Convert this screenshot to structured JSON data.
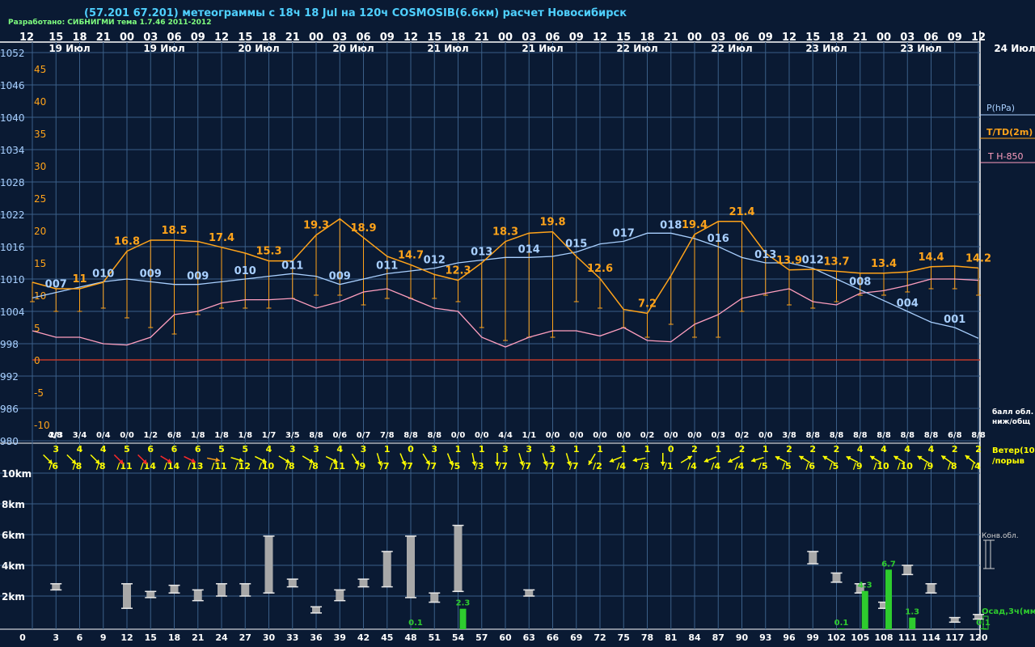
{
  "header": {
    "title": "(57.201 67.201) метеограммы с  18ч 18 Jul на 120ч COSMOSIB(6.6км) расчет Новосибирск",
    "developer": "Разработано: СИБНИГМИ тема 1.7.46 2011-2012"
  },
  "colors": {
    "background": "#0a1a33",
    "grid": "#3b5f88",
    "pressure": "#a9d0ff",
    "temperature": "#ffa31a",
    "t850": "#ff9fbf",
    "zero_line": "#c0392b",
    "cloud_bar": "#a8a8a8",
    "precip_bar": "#2ecc2e",
    "wind_yellow": "#ffff00",
    "wind_orange": "#ffa31a",
    "wind_red": "#ff2a2a"
  },
  "top_hours": [
    "12",
    "15",
    "18",
    "21",
    "00",
    "03",
    "06",
    "09",
    "12",
    "15",
    "18",
    "21",
    "00",
    "03",
    "06",
    "09",
    "12",
    "15",
    "18",
    "21",
    "00",
    "03",
    "06",
    "09",
    "12",
    "15",
    "18",
    "21",
    "00",
    "03",
    "06",
    "09",
    "12",
    "15",
    "18",
    "21",
    "00",
    "03",
    "06",
    "09",
    "12"
  ],
  "date_labels": [
    "19 Июл",
    "19 Июл",
    "20 Июл",
    "20 Июл",
    "21 Июл",
    "21 Июл",
    "22 Июл",
    "22 Июл",
    "23 Июл",
    "23 Июл",
    "24 Июл"
  ],
  "pressure_ticks": [
    "1052",
    "1046",
    "1040",
    "1034",
    "1028",
    "1022",
    "1016",
    "1010",
    "1004",
    "998",
    "992",
    "986",
    "980"
  ],
  "temp_ticks": [
    "45",
    "40",
    "35",
    "30",
    "25",
    "20",
    "15",
    "10",
    "5",
    "0",
    "-5",
    "-10"
  ],
  "legend": {
    "pressure": "P(hPa)",
    "temperature": "T/TD(2m)",
    "t850": "T H-850",
    "cloud_cover": "балл обл.\nниж/общ",
    "wind": "Ветер(10м)\n/порыв",
    "convective": "Конв.обл.",
    "precip": "Осад,3ч(мм)"
  },
  "height_ticks": [
    "10km",
    "8km",
    "6km",
    "4km",
    "2km"
  ],
  "bottom_hours": [
    "0",
    "3",
    "6",
    "9",
    "12",
    "15",
    "18",
    "21",
    "24",
    "27",
    "30",
    "33",
    "36",
    "39",
    "42",
    "45",
    "48",
    "51",
    "54",
    "57",
    "60",
    "63",
    "66",
    "69",
    "72",
    "75",
    "78",
    "81",
    "84",
    "87",
    "90",
    "93",
    "96",
    "99",
    "102",
    "105",
    "108",
    "111",
    "114",
    "117",
    "120"
  ],
  "chart_data": {
    "type": "line",
    "x_hours": [
      0,
      3,
      6,
      9,
      12,
      15,
      18,
      21,
      24,
      27,
      30,
      33,
      36,
      39,
      42,
      45,
      48,
      51,
      54,
      57,
      60,
      63,
      66,
      69,
      72,
      75,
      78,
      81,
      84,
      87,
      90,
      93,
      96,
      99,
      102,
      105,
      108,
      111,
      114,
      117,
      120
    ],
    "pressure_hpa": [
      1006.5,
      1007.5,
      1008.5,
      1009.5,
      1010,
      1009.5,
      1009,
      1009,
      1009.5,
      1010,
      1010.5,
      1011,
      1010.5,
      1009,
      1010,
      1011,
      1011.5,
      1012,
      1013,
      1013.5,
      1014,
      1014,
      1014.2,
      1015,
      1016.5,
      1017,
      1018.5,
      1018.5,
      1017.5,
      1016,
      1014,
      1013,
      1013,
      1012,
      1010,
      1008,
      1006,
      1004,
      1002,
      1001,
      999
    ],
    "pressure_labels": [
      {
        "h": 3,
        "t": "007"
      },
      {
        "h": 9,
        "t": "010"
      },
      {
        "h": 15,
        "t": "009"
      },
      {
        "h": 21,
        "t": "009"
      },
      {
        "h": 27,
        "t": "010"
      },
      {
        "h": 33,
        "t": "011"
      },
      {
        "h": 39,
        "t": "009"
      },
      {
        "h": 45,
        "t": "011"
      },
      {
        "h": 51,
        "t": "012"
      },
      {
        "h": 57,
        "t": "013"
      },
      {
        "h": 63,
        "t": "014"
      },
      {
        "h": 69,
        "t": "015"
      },
      {
        "h": 75,
        "t": "017"
      },
      {
        "h": 81,
        "t": "018"
      },
      {
        "h": 87,
        "t": "016"
      },
      {
        "h": 93,
        "t": "013"
      },
      {
        "h": 99,
        "t": "012"
      },
      {
        "h": 105,
        "t": "008"
      },
      {
        "h": 111,
        "t": "004"
      },
      {
        "h": 117,
        "t": "001"
      }
    ],
    "temperature_c": [
      12,
      11,
      11,
      12,
      16.8,
      18.5,
      18.5,
      18.3,
      17.4,
      16.5,
      15.3,
      15.3,
      19.3,
      21.8,
      18.9,
      16,
      14.7,
      13.2,
      12.3,
      15,
      18.3,
      19.6,
      19.8,
      16,
      12.6,
      7.8,
      7.2,
      13,
      19.4,
      21.4,
      21.4,
      16.5,
      13.9,
      14,
      13.7,
      13.4,
      13.4,
      13.6,
      14.4,
      14.5,
      14.2
    ],
    "dewpoint_c": [
      9,
      7.5,
      7.5,
      8,
      6.5,
      5,
      4,
      7,
      8,
      8,
      8,
      9.5,
      10,
      10,
      8.5,
      9.5,
      9.5,
      9.5,
      9,
      5,
      3,
      3.5,
      3.5,
      9,
      8,
      5,
      3.5,
      5.5,
      3.5,
      3.5,
      7.5,
      10,
      8.5,
      8,
      9,
      10,
      10,
      10.5,
      11,
      11,
      10
    ],
    "temperature_labels": [
      {
        "h": 6,
        "t": "11"
      },
      {
        "h": 12,
        "t": "16.8"
      },
      {
        "h": 18,
        "t": "18.5"
      },
      {
        "h": 24,
        "t": "17.4"
      },
      {
        "h": 30,
        "t": "15.3"
      },
      {
        "h": 36,
        "t": "19.3"
      },
      {
        "h": 42,
        "t": "18.9"
      },
      {
        "h": 48,
        "t": "14.7"
      },
      {
        "h": 54,
        "t": "12.3"
      },
      {
        "h": 60,
        "t": "18.3"
      },
      {
        "h": 66,
        "t": "19.8"
      },
      {
        "h": 72,
        "t": "12.6"
      },
      {
        "h": 78,
        "t": "7.2"
      },
      {
        "h": 84,
        "t": "19.4"
      },
      {
        "h": 90,
        "t": "21.4"
      },
      {
        "h": 96,
        "t": "13.9"
      },
      {
        "h": 102,
        "t": "13.7"
      },
      {
        "h": 108,
        "t": "13.4"
      },
      {
        "h": 114,
        "t": "14.4"
      },
      {
        "h": 120,
        "t": "14.2"
      }
    ],
    "t850_c": [
      4.5,
      3.5,
      3.5,
      2.5,
      2.3,
      3.5,
      7,
      7.5,
      8.8,
      9.3,
      9.3,
      9.5,
      8,
      9,
      10.5,
      11,
      9.5,
      8,
      7.5,
      3.5,
      2,
      3.5,
      4.5,
      4.5,
      3.7,
      5,
      3,
      2.8,
      5.5,
      7,
      9.5,
      10.3,
      11,
      9,
      8.5,
      10.3,
      10.7,
      11.5,
      12.5,
      12.5,
      12.3
    ],
    "cloud_cover": [
      "4/8",
      "2/3",
      "3/4",
      "0/4",
      "0/0",
      "1/2",
      "6/8",
      "1/8",
      "1/8",
      "1/8",
      "1/7",
      "3/5",
      "8/8",
      "0/6",
      "0/7",
      "7/8",
      "8/8",
      "8/8",
      "0/0",
      "0/0",
      "4/4",
      "1/1",
      "0/0",
      "0/0",
      "0/0",
      "0/0",
      "0/2",
      "0/0",
      "0/0",
      "0/3",
      "0/2",
      "0/0",
      "3/8",
      "8/8",
      "8/8",
      "8/8",
      "8/8",
      "8/8",
      "8/8",
      "6/8",
      "8/8"
    ],
    "wind": [
      {
        "s": "3",
        "g": "/6",
        "c": "y",
        "d": [
          1,
          1
        ]
      },
      {
        "s": "4",
        "g": "/8",
        "c": "y",
        "d": [
          1,
          1
        ]
      },
      {
        "s": "4",
        "g": "/8",
        "c": "y",
        "d": [
          1,
          1
        ]
      },
      {
        "s": "5",
        "g": "/11",
        "c": "r",
        "d": [
          1,
          1
        ]
      },
      {
        "s": "6",
        "g": "/14",
        "c": "r",
        "d": [
          1,
          1
        ]
      },
      {
        "s": "6",
        "g": "/14",
        "c": "r",
        "d": [
          1,
          0.6
        ]
      },
      {
        "s": "6",
        "g": "/13",
        "c": "r",
        "d": [
          1,
          0.5
        ]
      },
      {
        "s": "5",
        "g": "/11",
        "c": "o",
        "d": [
          1,
          0.2
        ]
      },
      {
        "s": "5",
        "g": "/12",
        "c": "y",
        "d": [
          1,
          0.3
        ]
      },
      {
        "s": "4",
        "g": "/10",
        "c": "y",
        "d": [
          1,
          0.5
        ]
      },
      {
        "s": "3",
        "g": "/8",
        "c": "y",
        "d": [
          1,
          0.6
        ]
      },
      {
        "s": "3",
        "g": "/8",
        "c": "y",
        "d": [
          1,
          0.6
        ]
      },
      {
        "s": "4",
        "g": "/11",
        "c": "y",
        "d": [
          1,
          0.5
        ]
      },
      {
        "s": "3",
        "g": "/9",
        "c": "y",
        "d": [
          0.6,
          1
        ]
      },
      {
        "s": "1",
        "g": "/7",
        "c": "y",
        "d": [
          0.3,
          1
        ]
      },
      {
        "s": "0",
        "g": "/7",
        "c": "y",
        "d": [
          0.4,
          1
        ]
      },
      {
        "s": "3",
        "g": "/7",
        "c": "y",
        "d": [
          0.6,
          1
        ]
      },
      {
        "s": "1",
        "g": "/5",
        "c": "y",
        "d": [
          0.4,
          1
        ]
      },
      {
        "s": "1",
        "g": "/3",
        "c": "y",
        "d": [
          0.2,
          1
        ]
      },
      {
        "s": "3",
        "g": "/7",
        "c": "y",
        "d": [
          0,
          1
        ]
      },
      {
        "s": "3",
        "g": "/7",
        "c": "y",
        "d": [
          0.3,
          1
        ]
      },
      {
        "s": "3",
        "g": "/7",
        "c": "y",
        "d": [
          0.3,
          1
        ]
      },
      {
        "s": "1",
        "g": "/7",
        "c": "y",
        "d": [
          0.3,
          1
        ]
      },
      {
        "s": "1",
        "g": "/2",
        "c": "y",
        "d": [
          -0.6,
          1
        ]
      },
      {
        "s": "1",
        "g": "/4",
        "c": "y",
        "d": [
          -1,
          0.4
        ]
      },
      {
        "s": "1",
        "g": "/3",
        "c": "y",
        "d": [
          -1,
          0.2
        ]
      },
      {
        "s": "0",
        "g": "/1",
        "c": "y",
        "d": [
          0,
          1
        ]
      },
      {
        "s": "2",
        "g": "/4",
        "c": "y",
        "d": [
          1,
          -0.6
        ]
      },
      {
        "s": "1",
        "g": "/4",
        "c": "y",
        "d": [
          -1,
          0.4
        ]
      },
      {
        "s": "2",
        "g": "/4",
        "c": "y",
        "d": [
          -1,
          0.5
        ]
      },
      {
        "s": "1",
        "g": "/5",
        "c": "y",
        "d": [
          -1,
          0.3
        ]
      },
      {
        "s": "2",
        "g": "/5",
        "c": "y",
        "d": [
          -1,
          -0.5
        ]
      },
      {
        "s": "2",
        "g": "/6",
        "c": "y",
        "d": [
          -1,
          -0.6
        ]
      },
      {
        "s": "2",
        "g": "/5",
        "c": "y",
        "d": [
          -1,
          -0.6
        ]
      },
      {
        "s": "4",
        "g": "/9",
        "c": "y",
        "d": [
          -1,
          -0.5
        ]
      },
      {
        "s": "4",
        "g": "/10",
        "c": "y",
        "d": [
          -1,
          -0.6
        ]
      },
      {
        "s": "4",
        "g": "/10",
        "c": "y",
        "d": [
          -1,
          -0.6
        ]
      },
      {
        "s": "4",
        "g": "/9",
        "c": "y",
        "d": [
          -1,
          -0.6
        ]
      },
      {
        "s": "2",
        "g": "/8",
        "c": "y",
        "d": [
          -1,
          -0.7
        ]
      },
      {
        "s": "2",
        "g": "/4",
        "c": "y",
        "d": [
          -1,
          -0.8
        ]
      }
    ],
    "cloud_layers_km": [
      {
        "h": 3,
        "b": 2.4,
        "t": 2.8
      },
      {
        "h": 12,
        "b": 1.2,
        "t": 2.8
      },
      {
        "h": 15,
        "b": 1.9,
        "t": 2.3
      },
      {
        "h": 18,
        "b": 2.2,
        "t": 2.7
      },
      {
        "h": 21,
        "b": 1.7,
        "t": 2.4
      },
      {
        "h": 24,
        "b": 2.0,
        "t": 2.8
      },
      {
        "h": 27,
        "b": 2.0,
        "t": 2.8
      },
      {
        "h": 30,
        "b": 2.2,
        "t": 5.9
      },
      {
        "h": 33,
        "b": 2.6,
        "t": 3.1
      },
      {
        "h": 36,
        "b": 0.9,
        "t": 1.3
      },
      {
        "h": 39,
        "b": 1.7,
        "t": 2.4
      },
      {
        "h": 42,
        "b": 2.6,
        "t": 3.1
      },
      {
        "h": 45,
        "b": 2.6,
        "t": 4.9
      },
      {
        "h": 48,
        "b": 1.9,
        "t": 5.9
      },
      {
        "h": 51,
        "b": 1.6,
        "t": 2.2
      },
      {
        "h": 54,
        "b": 2.3,
        "t": 6.6
      },
      {
        "h": 63,
        "b": 2.0,
        "t": 2.4
      },
      {
        "h": 99,
        "b": 4.1,
        "t": 4.9
      },
      {
        "h": 102,
        "b": 2.9,
        "t": 3.5
      },
      {
        "h": 105,
        "b": 2.2,
        "t": 2.8
      },
      {
        "h": 108,
        "b": 1.2,
        "t": 1.6
      },
      {
        "h": 111,
        "b": 3.4,
        "t": 4.0
      },
      {
        "h": 114,
        "b": 2.2,
        "t": 2.8
      },
      {
        "h": 117,
        "b": 0.3,
        "t": 0.6
      },
      {
        "h": 120,
        "b": 0.5,
        "t": 0.8
      }
    ],
    "precip_mm": [
      {
        "h": 48,
        "v": 0.1,
        "t": "0.1"
      },
      {
        "h": 54,
        "v": 2.3,
        "t": "2.3"
      },
      {
        "h": 102,
        "v": 0.1,
        "t": "0.1"
      },
      {
        "h": 105,
        "v": 4.3,
        "t": "4.3"
      },
      {
        "h": 108,
        "v": 6.7,
        "t": "6.7"
      },
      {
        "h": 111,
        "v": 1.3,
        "t": "1.3"
      },
      {
        "h": 120,
        "v": 0.1,
        "t": "0.1"
      }
    ],
    "pressure_range": [
      980,
      1052
    ],
    "temp_range": [
      -12.5,
      47.5
    ],
    "height_range_km": [
      0,
      11
    ]
  }
}
